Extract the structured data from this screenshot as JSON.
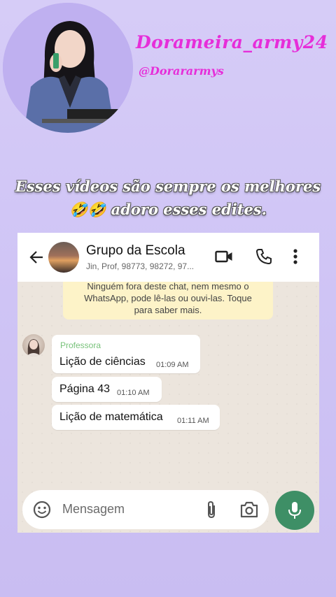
{
  "profile": {
    "username": "Dorameira_army24",
    "handle": "@Dorararmys"
  },
  "caption": {
    "line1": "Esses vídeos são sempre os melhores",
    "emojis": "🤣🤣",
    "line2_rest": " adoro esses edites."
  },
  "chat": {
    "group_name": "Grupo da Escola",
    "members": "Jin, Prof, 98773, 98272, 97...",
    "notice": [
      "Ninguém fora deste chat, nem mesmo o",
      "WhatsApp, pode lê-las ou ouvi-las. Toque",
      "para saber mais."
    ],
    "messages": [
      {
        "sender": "Professora",
        "text": "Lição de ciências",
        "time": "01:09 AM"
      },
      {
        "text": "Página 43",
        "time": "01:10 AM"
      },
      {
        "text": "Lição de matemática",
        "time": "01:11 AM"
      }
    ],
    "input_placeholder": "Mensagem"
  },
  "colors": {
    "accent_pink": "#e62ed9",
    "whatsapp_green": "#3e8f66",
    "sender_name_green": "#78c27a"
  },
  "icons": [
    "back-arrow",
    "video-call",
    "phone-call",
    "more-vertical",
    "emoji-face",
    "attach-paperclip",
    "camera",
    "microphone"
  ]
}
